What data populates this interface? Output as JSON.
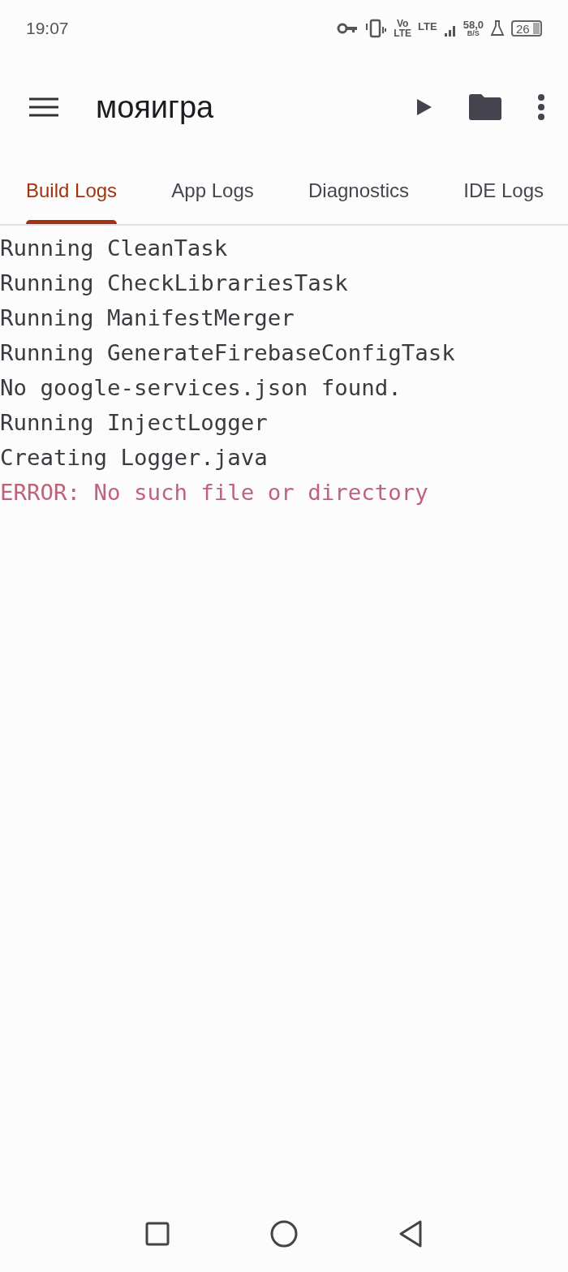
{
  "status_bar": {
    "time": "19:07",
    "volte_top": "Vo",
    "volte_bottom": "LTE",
    "network": "LTE",
    "speed": "58,0",
    "speed_unit": "B/S",
    "battery": "26"
  },
  "app_bar": {
    "title": "мояигра"
  },
  "tabs": [
    {
      "label": "Build Logs",
      "selected": true
    },
    {
      "label": "App Logs",
      "selected": false
    },
    {
      "label": "Diagnostics",
      "selected": false
    },
    {
      "label": "IDE Logs",
      "selected": false
    }
  ],
  "log_lines": [
    {
      "text": "Running CleanTask",
      "kind": "info"
    },
    {
      "text": "Running CheckLibrariesTask",
      "kind": "info"
    },
    {
      "text": "Running ManifestMerger",
      "kind": "info"
    },
    {
      "text": "Running GenerateFirebaseConfigTask",
      "kind": "info"
    },
    {
      "text": "No google-services.json found.",
      "kind": "info"
    },
    {
      "text": "Running InjectLogger",
      "kind": "info"
    },
    {
      "text": "Creating Logger.java",
      "kind": "info"
    },
    {
      "text": "ERROR: No such file or directory",
      "kind": "error"
    }
  ]
}
